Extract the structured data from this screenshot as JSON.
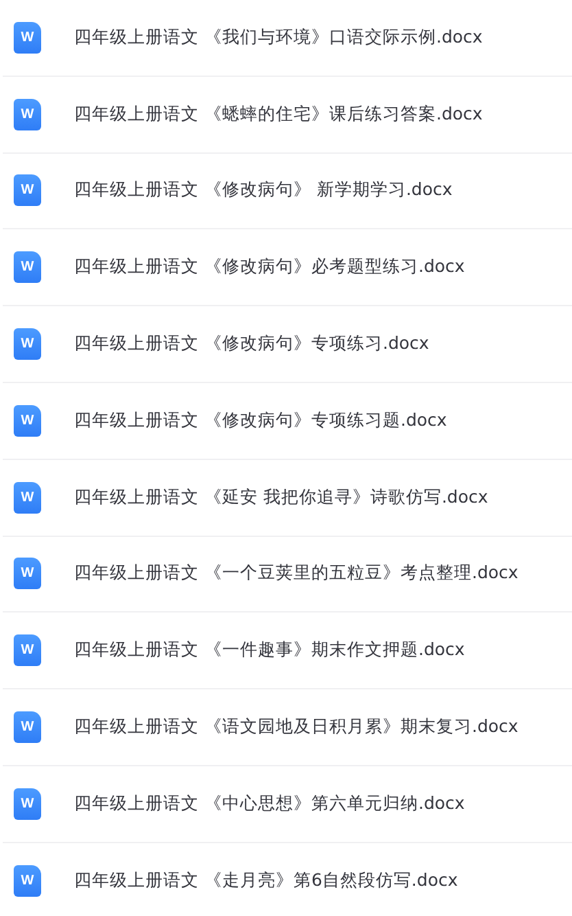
{
  "files": [
    {
      "icon": "W",
      "name": "四年级上册语文 《我们与环境》口语交际示例.docx"
    },
    {
      "icon": "W",
      "name": "四年级上册语文 《蟋蟀的住宅》课后练习答案.docx"
    },
    {
      "icon": "W",
      "name": "四年级上册语文 《修改病句》 新学期学习.docx"
    },
    {
      "icon": "W",
      "name": "四年级上册语文 《修改病句》必考题型练习.docx"
    },
    {
      "icon": "W",
      "name": "四年级上册语文 《修改病句》专项练习.docx"
    },
    {
      "icon": "W",
      "name": "四年级上册语文 《修改病句》专项练习题.docx"
    },
    {
      "icon": "W",
      "name": "四年级上册语文 《延安 我把你追寻》诗歌仿写.docx"
    },
    {
      "icon": "W",
      "name": "四年级上册语文 《一个豆荚里的五粒豆》考点整理.docx"
    },
    {
      "icon": "W",
      "name": "四年级上册语文 《一件趣事》期末作文押题.docx"
    },
    {
      "icon": "W",
      "name": "四年级上册语文 《语文园地及日积月累》期末复习.docx"
    },
    {
      "icon": "W",
      "name": "四年级上册语文 《中心思想》第六单元归纳.docx"
    },
    {
      "icon": "W",
      "name": "四年级上册语文 《走月亮》第6自然段仿写.docx"
    }
  ]
}
